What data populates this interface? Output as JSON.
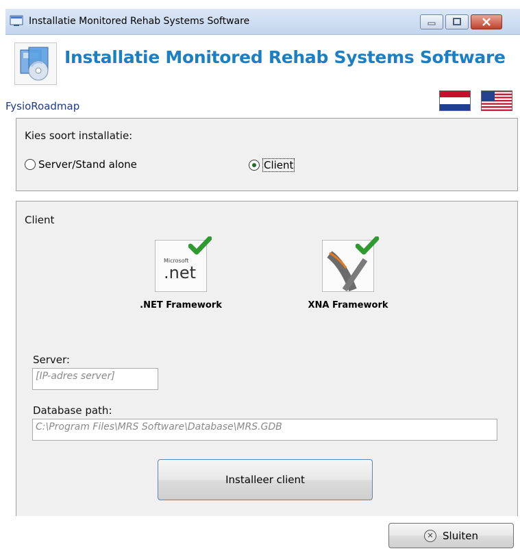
{
  "window": {
    "title": "Installatie Monitored Rehab Systems Software"
  },
  "header": {
    "heading": "Installatie Monitored Rehab Systems Software",
    "brand": "FysioRoadmap",
    "languages": [
      "nl-flag",
      "us-flag"
    ]
  },
  "install_type": {
    "label": "Kies soort installatie:",
    "options": [
      {
        "label": "Server/Stand alone",
        "selected": false
      },
      {
        "label": "Client",
        "selected": true
      }
    ]
  },
  "client_panel": {
    "title": "Client",
    "components": [
      {
        "name": ".NET Framework",
        "icon": "dotnet-icon",
        "installed": true
      },
      {
        "name": "XNA Framework",
        "icon": "xna-icon",
        "installed": true
      }
    ],
    "server_label": "Server:",
    "server_placeholder": "[IP-adres server]",
    "db_label": "Database path:",
    "db_value": "C:\\Program Files\\MRS Software\\Database\\MRS.GDB",
    "install_button": "Installeer client"
  },
  "footer": {
    "close_button": "Sluiten"
  },
  "colors": {
    "heading": "#1b7fc4",
    "brand": "#1d3a8a",
    "check": "#3aa53a",
    "panel_bg": "#f0f0f0"
  }
}
